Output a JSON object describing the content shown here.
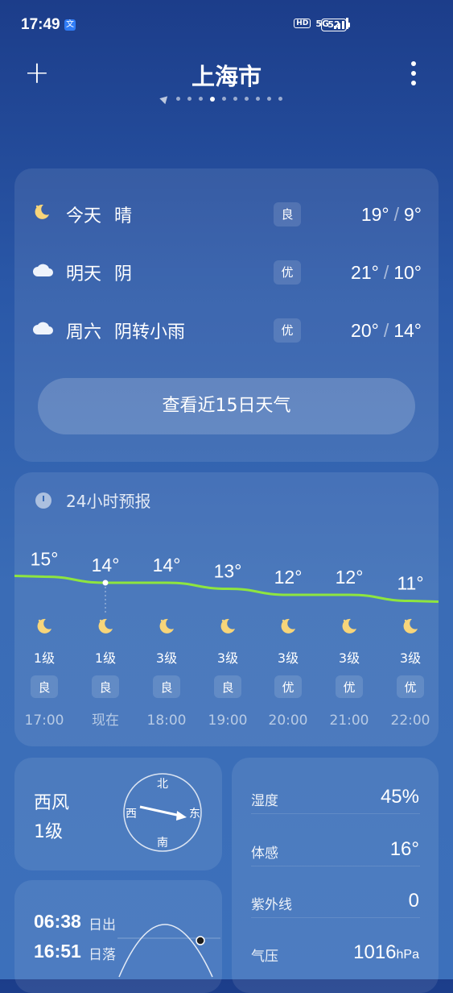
{
  "status": {
    "time": "17:49",
    "app_badge": "文",
    "hd": "HD",
    "network": "5G",
    "battery": "52"
  },
  "header": {
    "city": "上海市",
    "page_count": 11,
    "active_page": 4
  },
  "daily": [
    {
      "icon": "moon-icon",
      "day": "今天",
      "condition": "晴",
      "aqi": "良",
      "high": "19°",
      "low": "9°"
    },
    {
      "icon": "cloud-icon",
      "day": "明天",
      "condition": "阴",
      "aqi": "优",
      "high": "21°",
      "low": "10°"
    },
    {
      "icon": "cloud-icon",
      "day": "周六",
      "condition": "阴转小雨",
      "aqi": "优",
      "high": "20°",
      "low": "14°"
    }
  ],
  "forecast_button": "查看近15日天气",
  "hourly_title": "24小时预报",
  "hourly": [
    {
      "temp": "15°",
      "temp_value": 15,
      "wind": "1级",
      "aqi": "良",
      "time": "17:00",
      "icon": "moon-icon"
    },
    {
      "temp": "14°",
      "temp_value": 14,
      "wind": "1级",
      "aqi": "良",
      "time": "现在",
      "icon": "moon-icon"
    },
    {
      "temp": "14°",
      "temp_value": 14,
      "wind": "3级",
      "aqi": "良",
      "time": "18:00",
      "icon": "moon-icon"
    },
    {
      "temp": "13°",
      "temp_value": 13,
      "wind": "3级",
      "aqi": "良",
      "time": "19:00",
      "icon": "moon-icon"
    },
    {
      "temp": "12°",
      "temp_value": 12,
      "wind": "3级",
      "aqi": "优",
      "time": "20:00",
      "icon": "moon-icon"
    },
    {
      "temp": "12°",
      "temp_value": 12,
      "wind": "3级",
      "aqi": "优",
      "time": "21:00",
      "icon": "moon-icon"
    },
    {
      "temp": "11°",
      "temp_value": 11,
      "wind": "3级",
      "aqi": "优",
      "time": "22:00",
      "icon": "moon-icon"
    }
  ],
  "wind": {
    "direction": "西风",
    "level": "1级",
    "compass": {
      "n": "北",
      "e": "东",
      "s": "南",
      "w": "西"
    }
  },
  "details": [
    {
      "label": "湿度",
      "value": "45%"
    },
    {
      "label": "体感",
      "value": "16°"
    },
    {
      "label": "紫外线",
      "value": "0"
    },
    {
      "label": "气压",
      "value": "1016",
      "unit": "hPa"
    }
  ],
  "sun": {
    "sunrise": "06:38",
    "sunrise_label": "日出",
    "sunset": "16:51",
    "sunset_label": "日落"
  },
  "colors": {
    "temp_line": "#8ee53f",
    "card": "rgba(255,255,255,0.09)"
  }
}
